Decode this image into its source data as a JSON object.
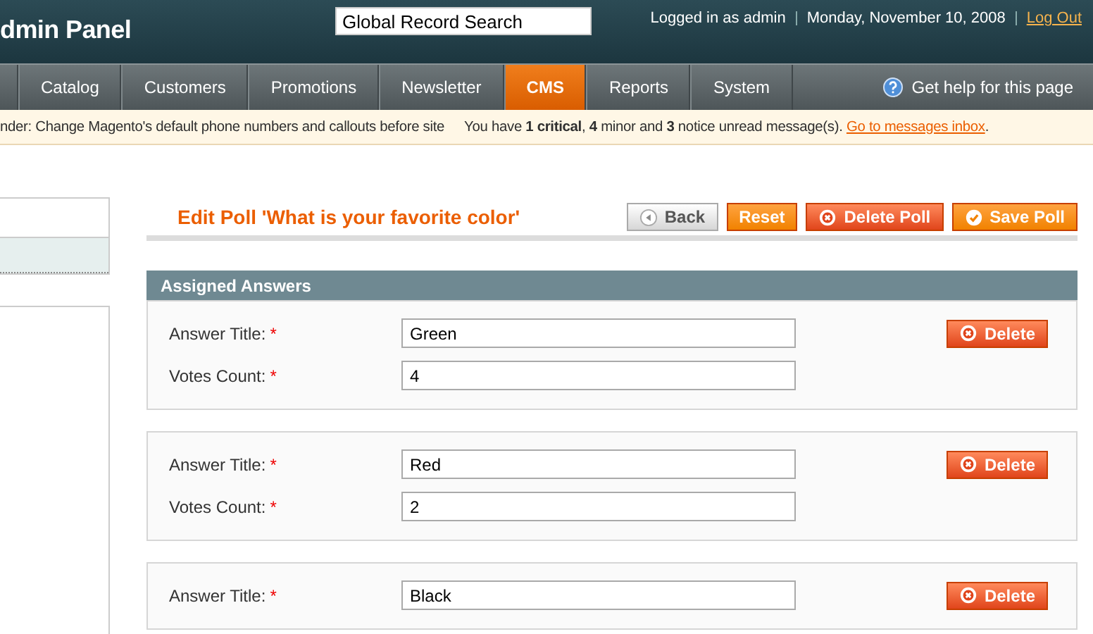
{
  "header": {
    "title": "dmin Panel",
    "search": {
      "value": "Global Record Search"
    },
    "user": "Logged in as admin",
    "date": "Monday, November 10, 2008",
    "logout": "Log Out"
  },
  "nav": {
    "items": [
      {
        "label": "Catalog",
        "selected": false
      },
      {
        "label": "Customers",
        "selected": false
      },
      {
        "label": "Promotions",
        "selected": false
      },
      {
        "label": "Newsletter",
        "selected": false
      },
      {
        "label": "CMS",
        "selected": true
      },
      {
        "label": "Reports",
        "selected": false
      },
      {
        "label": "System",
        "selected": false
      }
    ],
    "help": "Get help for this page"
  },
  "notice": {
    "reminder": "nder: Change Magento's default phone numbers and callouts before site",
    "messages": "You have **1 critical**, **4** minor and **3** notice unread message(s).",
    "link": "Go to messages inbox",
    "suffix": "."
  },
  "page_title": "Edit Poll 'What is your favorite color'",
  "buttons": [
    {
      "label": "Back",
      "kind": "back"
    },
    {
      "label": "Reset",
      "kind": "plain"
    },
    {
      "label": "Delete Poll",
      "kind": "delete"
    },
    {
      "label": "Save Poll",
      "kind": "save"
    }
  ],
  "section": {
    "title": "Assigned Answers",
    "answers": [
      {
        "fields": [
          {
            "label": "Answer Title:",
            "mark": "*",
            "value": "Green"
          },
          {
            "label": "Votes Count:",
            "mark": "*",
            "value": "4"
          }
        ],
        "delete": "Delete"
      },
      {
        "fields": [
          {
            "label": "Answer Title:",
            "mark": "*",
            "value": "Red"
          },
          {
            "label": "Votes Count:",
            "mark": "*",
            "value": "2"
          }
        ],
        "delete": "Delete"
      },
      {
        "fields": [
          {
            "label": "Answer Title:",
            "mark": "*",
            "value": "Black"
          }
        ],
        "delete": "Delete"
      }
    ]
  }
}
